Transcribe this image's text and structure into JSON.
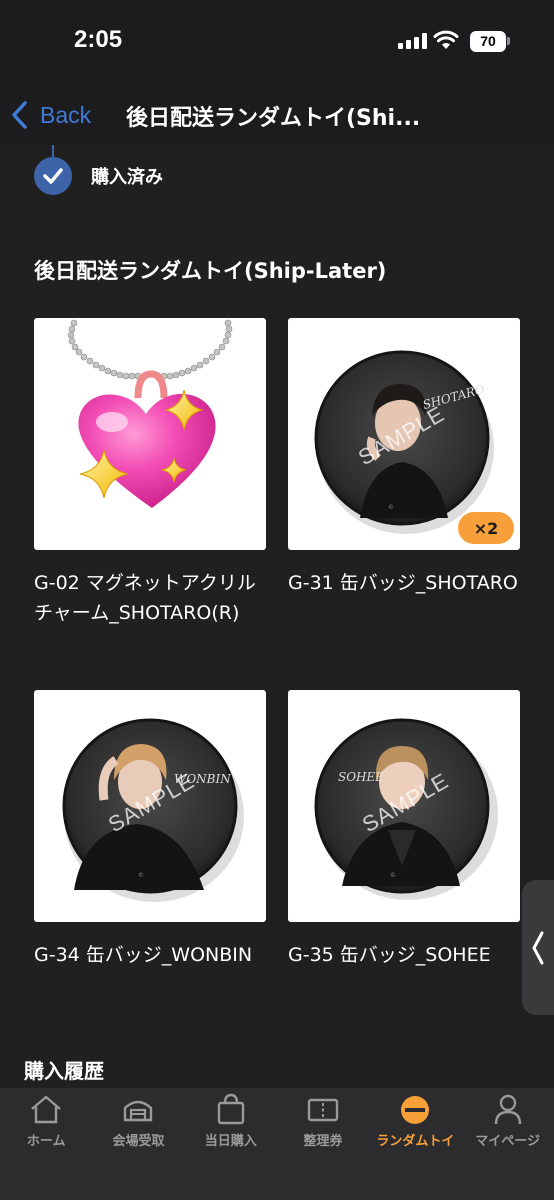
{
  "status_bar": {
    "time": "2:05",
    "battery": "70"
  },
  "nav": {
    "back_label": "Back",
    "title": "後日配送ランダムトイ(Shi..."
  },
  "purchase_status": "購入済み",
  "section_title": "後日配送ランダムトイ(Ship-Later)",
  "items": [
    {
      "name": "G-02 マグネットアクリルチャーム_SHOTARO(R)",
      "image": "heart-charm",
      "quantity": ""
    },
    {
      "name": "G-31 缶バッジ_SHOTARO",
      "image": "button-badge",
      "quantity": "×2",
      "badge_signature": "SHOTARO",
      "watermark": "SAMPLE",
      "badge_footer": "©"
    },
    {
      "name": "G-34 缶バッジ_WONBIN",
      "image": "button-badge",
      "quantity": "",
      "badge_signature": "WONBIN",
      "watermark": "SAMPLE",
      "badge_footer": "©"
    },
    {
      "name": "G-35 缶バッジ_SOHEE",
      "image": "button-badge",
      "quantity": "",
      "badge_signature": "SOHEE",
      "watermark": "SAMPLE",
      "badge_footer": "©"
    }
  ],
  "history_title": "購入履歴",
  "tabs": [
    {
      "label": "ホーム",
      "icon": "home-icon",
      "active": false
    },
    {
      "label": "会場受取",
      "icon": "venue-icon",
      "active": false
    },
    {
      "label": "当日購入",
      "icon": "shopping-bag-icon",
      "active": false
    },
    {
      "label": "整理券",
      "icon": "ticket-icon",
      "active": false
    },
    {
      "label": "ランダムトイ",
      "icon": "random-toy-icon",
      "active": true
    },
    {
      "label": "マイページ",
      "icon": "person-icon",
      "active": false
    }
  ],
  "colors": {
    "accent": "#f7a03a",
    "link": "#3d7bd6",
    "check": "#3d63a8",
    "background": "#202020"
  }
}
